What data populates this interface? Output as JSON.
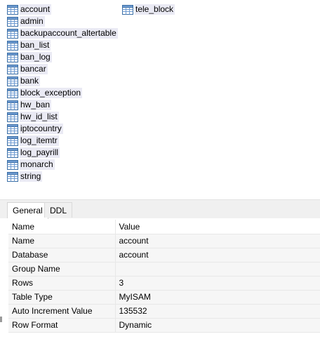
{
  "tables_col1": [
    "account",
    "admin",
    "backupaccount_altertable",
    "ban_list",
    "ban_log",
    "bancar",
    "bank",
    "block_exception",
    "hw_ban",
    "hw_id_list",
    "iptocountry",
    "log_itemtr",
    "log_payrill",
    "monarch",
    "string"
  ],
  "tables_col2": [
    "tele_block"
  ],
  "tabs": {
    "general": "General",
    "ddl": "DDL"
  },
  "props": {
    "header": {
      "name": "Name",
      "value": "Value"
    },
    "rows": [
      {
        "name": "Name",
        "value": "account"
      },
      {
        "name": "Database",
        "value": "account"
      },
      {
        "name": "Group Name",
        "value": ""
      },
      {
        "name": "Rows",
        "value": "3"
      },
      {
        "name": "Table Type",
        "value": "MyISAM"
      },
      {
        "name": "Auto Increment Value",
        "value": "135532"
      },
      {
        "name": "Row Format",
        "value": "Dynamic"
      }
    ]
  },
  "icon": {
    "name": "table-icon",
    "color": "#3a6ea5"
  }
}
